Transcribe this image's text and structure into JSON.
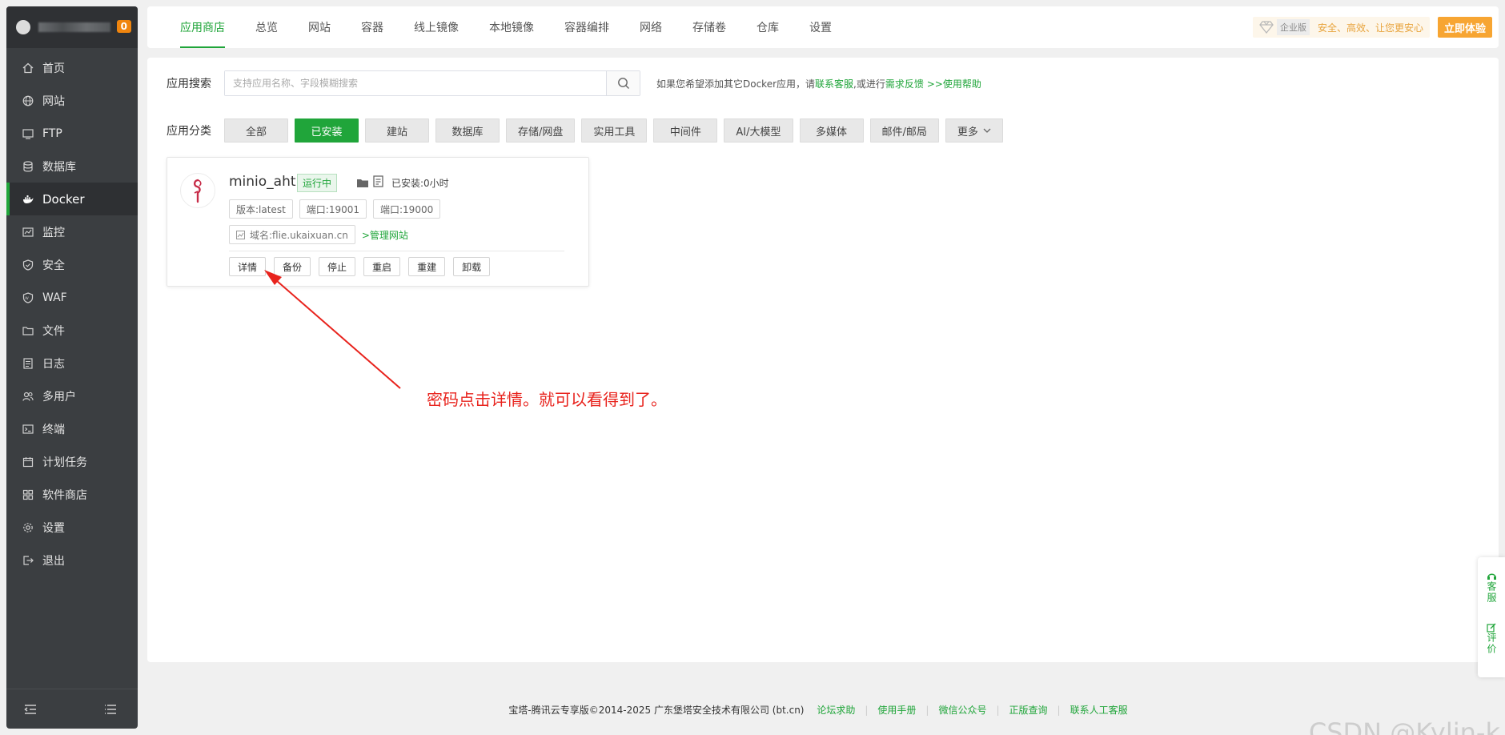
{
  "sidebar": {
    "badge": "0",
    "items": [
      {
        "label": "首页",
        "icon": "home-icon"
      },
      {
        "label": "网站",
        "icon": "globe-icon"
      },
      {
        "label": "FTP",
        "icon": "ftp-icon"
      },
      {
        "label": "数据库",
        "icon": "database-icon"
      },
      {
        "label": "Docker",
        "icon": "docker-icon"
      },
      {
        "label": "监控",
        "icon": "monitor-icon"
      },
      {
        "label": "安全",
        "icon": "shield-icon"
      },
      {
        "label": "WAF",
        "icon": "waf-icon"
      },
      {
        "label": "文件",
        "icon": "folder-icon"
      },
      {
        "label": "日志",
        "icon": "log-icon"
      },
      {
        "label": "多用户",
        "icon": "users-icon"
      },
      {
        "label": "终端",
        "icon": "terminal-icon"
      },
      {
        "label": "计划任务",
        "icon": "calendar-icon"
      },
      {
        "label": "软件商店",
        "icon": "apps-icon"
      },
      {
        "label": "设置",
        "icon": "gear-icon"
      },
      {
        "label": "退出",
        "icon": "logout-icon"
      }
    ],
    "active_index": 4
  },
  "topnav": {
    "tabs": [
      "应用商店",
      "总览",
      "网站",
      "容器",
      "线上镜像",
      "本地镜像",
      "容器编排",
      "网络",
      "存储卷",
      "仓库",
      "设置"
    ],
    "active_tab": 0,
    "enterprise_tag": "企业版",
    "enterprise_text": "安全、高效、让您更安心",
    "enterprise_button": "立即体验"
  },
  "search": {
    "label": "应用搜索",
    "placeholder": "支持应用名称、字段模糊搜索",
    "hint_prefix": "如果您希望添加其它Docker应用，请",
    "hint_link1": "联系客服",
    "hint_mid": ",或进行",
    "hint_link2": "需求反馈",
    "hint_link3": ">>使用帮助"
  },
  "category": {
    "label": "应用分类",
    "items": [
      "全部",
      "已安装",
      "建站",
      "数据库",
      "存储/网盘",
      "实用工具",
      "中间件",
      "AI/大模型",
      "多媒体",
      "邮件/邮局"
    ],
    "active_index": 1,
    "more": "更多"
  },
  "app_card": {
    "name": "minio_ahth",
    "status": "运行中",
    "installed": "已安装:0小时",
    "version": "版本:latest",
    "port1": "端口:19001",
    "port2": "端口:19000",
    "domain": "域名:flie.ukaixuan.cn",
    "manage_link": ">管理网站",
    "actions": [
      "详情",
      "备份",
      "停止",
      "重启",
      "重建",
      "卸载"
    ]
  },
  "annotation": {
    "text": "密码点击详情。就可以看得到了。",
    "color": "#e8231d"
  },
  "footer": {
    "copyright": "宝塔-腾讯云专享版©2014-2025 广东堡塔安全技术有限公司 (bt.cn)",
    "links": [
      "论坛求助",
      "使用手册",
      "微信公众号",
      "正版查询",
      "联系人工客服"
    ]
  },
  "float_panel": {
    "service": "客服",
    "review": "评价"
  },
  "watermark": "CSDN @Kylin-k",
  "colors": {
    "accent": "#20a53a",
    "sidebar_bg": "#3b3e41",
    "warning": "#f7a532"
  }
}
